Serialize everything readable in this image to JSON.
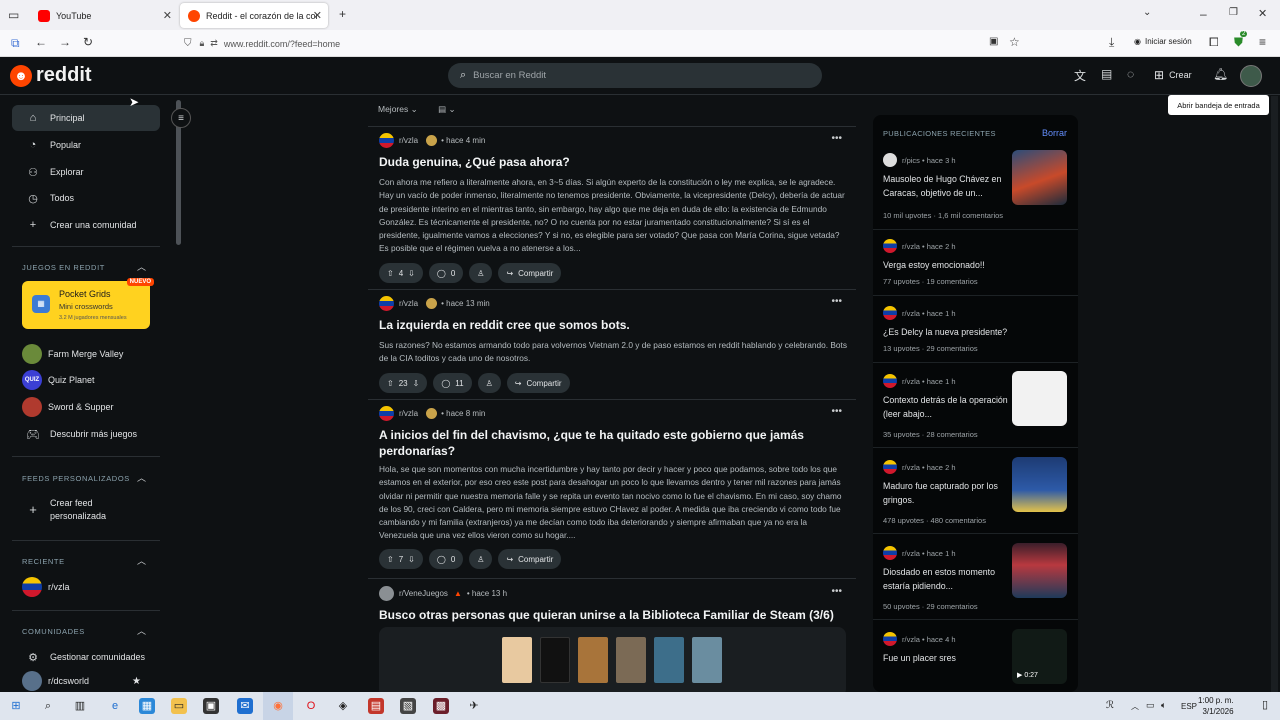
{
  "browser": {
    "tabs": [
      {
        "label": "YouTube",
        "icon": "youtube-icon",
        "color": "#ff0000"
      },
      {
        "label": "Reddit - el corazón de la conve",
        "icon": "reddit-icon",
        "color": "#ff4500"
      }
    ],
    "url": "www.reddit.com/?feed=home",
    "signin_label": "Iniciar sesión",
    "badge_count": "2"
  },
  "header": {
    "logo": "reddit",
    "search_placeholder": "Buscar en Reddit",
    "create_label": "Crear",
    "tooltip": "Abrir bandeja de entrada"
  },
  "sidebar": {
    "nav": [
      {
        "label": "Principal",
        "icon": "home-icon"
      },
      {
        "label": "Popular",
        "icon": "popular-icon"
      },
      {
        "label": "Explorar",
        "icon": "explore-icon"
      },
      {
        "label": "Todos",
        "icon": "all-icon"
      },
      {
        "label": "Crear una comunidad",
        "icon": "plus-icon"
      }
    ],
    "games_header": "JUEGOS EN REDDIT",
    "featured_game": {
      "title": "Pocket Grids",
      "subtitle": "Mini crosswords",
      "players": "3.2 M jugadores mensuales",
      "badge": "NUEVO"
    },
    "games": [
      {
        "label": "Farm Merge Valley"
      },
      {
        "label": "Quiz Planet"
      },
      {
        "label": "Sword & Supper"
      },
      {
        "label": "Descubrir más juegos"
      }
    ],
    "custom_feeds_header": "FEEDS PERSONALIZADOS",
    "create_feed": "Crear feed personalizada",
    "recent_header": "RECIENTE",
    "recent_community": "r/vzla",
    "communities_header": "COMUNIDADES",
    "manage_communities": "Gestionar comunidades",
    "community_1": "r/dcsworld"
  },
  "feed": {
    "sort": "Mejores",
    "posts": [
      {
        "subreddit": "r/vzla",
        "time": "hace 4 min",
        "title": "Duda genuina, ¿Qué pasa ahora?",
        "body": "Con ahora me refiero a literalmente ahora, en 3~5 días. Si algún experto de la constitución o ley me explica, se le agradece. Hay un vacío de poder inmenso, literalmente no tenemos presidente. Obviamente, la vicepresidente (Delcy), debería de actuar de presidente interino en el mientras tanto, sin embargo, hay algo que me deja en duda de ello: la existencia de Edmundo González. Es técnicamente el presidente, no? O no cuenta por no estar juramentado constitucionalmente? Si sí es el presidente, igualmente vamos a elecciones? Y si no, es elegible para ser votado? Que pasa con María Corina, sigue vetada? Es posible que el régimen vuelva a no atenerse a los...",
        "votes": "4",
        "comments": "0",
        "share": "Compartir"
      },
      {
        "subreddit": "r/vzla",
        "time": "hace 13 min",
        "title": "La izquierda en reddit cree que somos bots.",
        "body": "Sus razones? No estamos armando todo para volvernos Vietnam 2.0 y de paso estamos en reddit hablando y celebrando. Bots de la CIA toditos y cada uno de nosotros.",
        "votes": "23",
        "comments": "11",
        "share": "Compartir"
      },
      {
        "subreddit": "r/vzla",
        "time": "hace 8 min",
        "title": "A inicios del fin del chavismo, ¿que te ha quitado este gobierno que jamás perdonarías?",
        "body": "Hola, se que son momentos con mucha incertidumbre y hay tanto por decir y hacer y poco que podamos, sobre todo los que estamos en el exterior, por eso creo este post para desahogar un poco lo que llevamos dentro y tener mil razones para jamás olvidar ni permitir que nuestra memoria falle y se repita un evento tan nocivo como lo fue el chavismo. En mi caso, soy chamo de los 90, creci con Caldera, pero mi memoria siempre estuvo CHavez al poder. A medida que iba creciendo vi como todo fue cambiando y mi familia (extranjeros) ya me decían como todo iba deteriorando y siempre afirmaban que ya no era la Venezuela que una vez ellos vieron como su hogar....",
        "votes": "7",
        "comments": "0",
        "share": "Compartir"
      },
      {
        "subreddit": "r/VeneJuegos",
        "time": "hace 13 h",
        "title": "Busco otras personas que quieran unirse a la Biblioteca Familiar de Steam (3/6)"
      }
    ]
  },
  "recent_posts": {
    "header": "PUBLICACIONES RECIENTES",
    "clear": "Borrar",
    "items": [
      {
        "sub": "r/pics",
        "time": "hace 3 h",
        "title": "Mausoleo de Hugo Chávez en Caracas, objetivo de un...",
        "stats": "10 mil upvotes · 1,6 mil comentarios",
        "thumb": true
      },
      {
        "sub": "r/vzla",
        "time": "hace 2 h",
        "title": "Verga estoy emocionado!!",
        "stats": "77 upvotes · 19 comentarios",
        "thumb": false
      },
      {
        "sub": "r/vzla",
        "time": "hace 1 h",
        "title": "¿Es Delcy la nueva presidente?",
        "stats": "13 upvotes · 29 comentarios",
        "thumb": false
      },
      {
        "sub": "r/vzla",
        "time": "hace 1 h",
        "title": "Contexto detrás de la operación (leer abajo...",
        "stats": "35 upvotes · 28 comentarios",
        "thumb": true
      },
      {
        "sub": "r/vzla",
        "time": "hace 2 h",
        "title": "Maduro fue capturado por los gringos.",
        "stats": "478 upvotes · 480 comentarios",
        "thumb": true
      },
      {
        "sub": "r/vzla",
        "time": "hace 1 h",
        "title": "Diosdado en estos momento estaría pidiendo...",
        "stats": "50 upvotes · 29 comentarios",
        "thumb": true
      },
      {
        "sub": "r/vzla",
        "time": "hace 4 h",
        "title": "Fue un placer sres",
        "stats": "",
        "thumb": true,
        "duration": "0:27"
      }
    ]
  },
  "taskbar": {
    "lang": "ESP",
    "time": "1:00 p. m.",
    "date": "3/1/2026"
  },
  "colors": {
    "reddit_orange": "#ff4500",
    "bg": "#0e1113",
    "link_blue": "#648efc"
  }
}
